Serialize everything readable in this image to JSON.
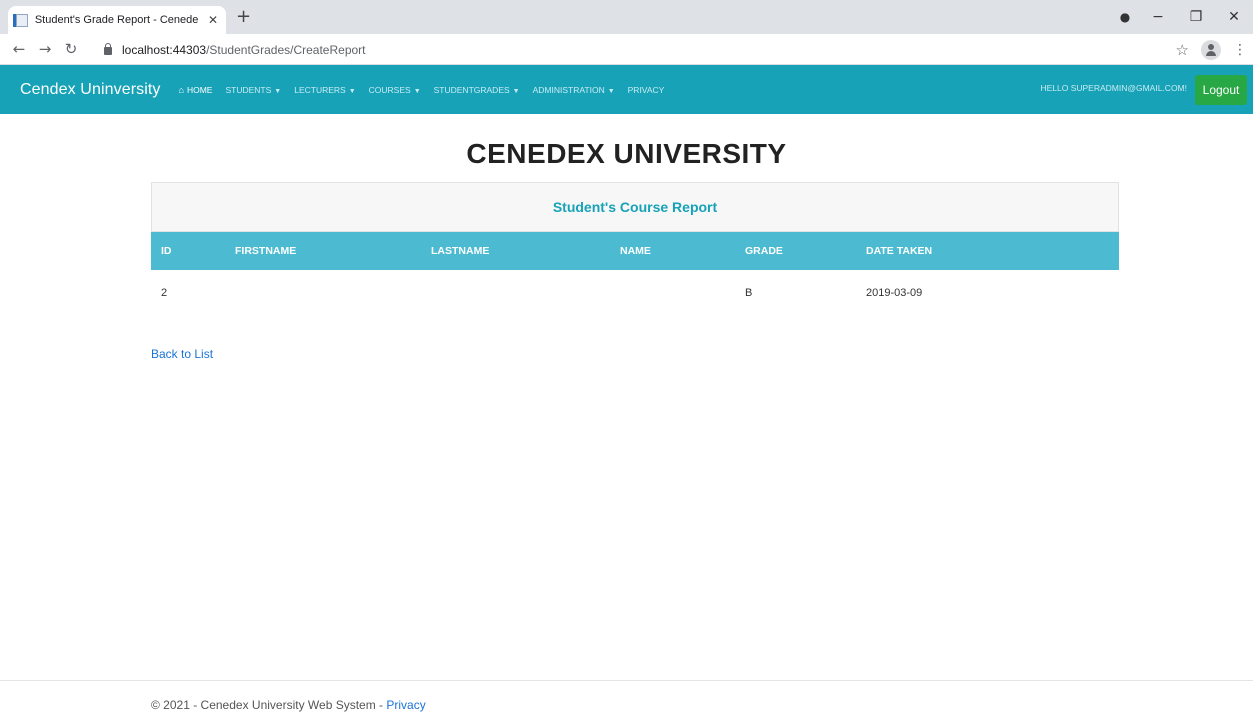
{
  "browser": {
    "tab_title": "Student's Grade Report - Cenede",
    "tab_close": "✕",
    "new_tab": "+",
    "url_host": "localhost:44303",
    "url_path": "/StudentGrades/CreateReport",
    "icons": [
      "favicon-icon",
      "back-icon",
      "forward-icon",
      "reload-icon",
      "lock-icon",
      "star-icon",
      "profile-icon",
      "kebab-menu-icon",
      "minimize-icon",
      "restore-icon",
      "close-icon"
    ]
  },
  "navbar": {
    "brand": "Cendex Uninversity",
    "links": [
      {
        "label": "HOME",
        "active": true
      },
      {
        "label": "STUDENTS",
        "dropdown": true
      },
      {
        "label": "LECTURERS",
        "dropdown": true
      },
      {
        "label": "COURSES",
        "dropdown": true
      },
      {
        "label": "STUDENTGRADES",
        "dropdown": true
      },
      {
        "label": "ADMINISTRATION",
        "dropdown": true
      },
      {
        "label": "PRIVACY"
      }
    ],
    "greeting": "HELLO SUPERADMIN@GMAIL.COM!",
    "logout_label": "Logout",
    "colors": {
      "navbar": "#17a2b8",
      "logout": "#28a745"
    }
  },
  "main": {
    "heading": "CENEDEX UNIVERSITY",
    "report_title": "Student's Course Report",
    "table": {
      "columns": [
        "ID",
        "FIRSTNAME",
        "LASTNAME",
        "NAME",
        "GRADE",
        "DATE TAKEN"
      ],
      "rows": [
        [
          "2",
          "",
          "",
          "",
          "B",
          "2019-03-09"
        ]
      ],
      "header_color": "#4cbbd2"
    },
    "back_link": "Back to List"
  },
  "footer": {
    "text": "© 2021 - Cenedex University Web System - ",
    "privacy_link": "Privacy"
  }
}
